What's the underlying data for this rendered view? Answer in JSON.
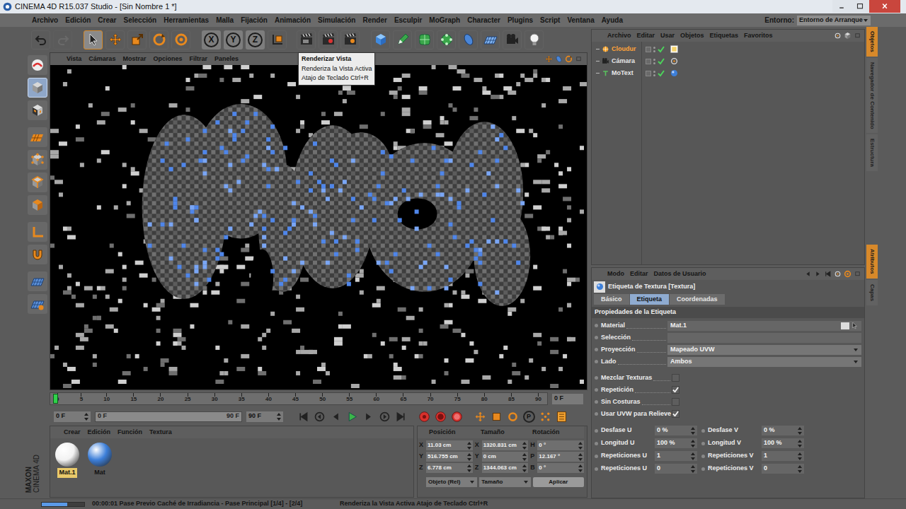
{
  "window": {
    "title": "CINEMA 4D R15.037 Studio - [Sin Nombre 1 *]",
    "controls": [
      {
        "kind": "minimize"
      },
      {
        "kind": "maximize"
      },
      {
        "kind": "close"
      }
    ]
  },
  "menu": [
    "Archivo",
    "Edición",
    "Crear",
    "Selección",
    "Herramientas",
    "Malla",
    "Fijación",
    "Animación",
    "Simulación",
    "Render",
    "Esculpir",
    "MoGraph",
    "Character",
    "Plugins",
    "Script",
    "Ventana",
    "Ayuda"
  ],
  "layout": {
    "label": "Entorno:",
    "value": "Entorno de Arranque"
  },
  "toolbar": [
    {
      "kind": "undo",
      "label": "",
      "selected": false,
      "disabled": false
    },
    {
      "kind": "redo",
      "label": "",
      "selected": false,
      "disabled": true
    },
    {
      "kind": "select",
      "label": "",
      "selected": true,
      "disabled": false
    },
    {
      "kind": "move",
      "label": "",
      "selected": false,
      "disabled": false
    },
    {
      "kind": "scale",
      "label": "",
      "selected": false,
      "disabled": false
    },
    {
      "kind": "rotate",
      "label": "",
      "selected": false,
      "disabled": false
    },
    {
      "kind": "recent",
      "label": "",
      "selected": false,
      "disabled": false
    },
    {
      "kind": "axis",
      "label": "X",
      "selected": true,
      "disabled": false
    },
    {
      "kind": "axis",
      "label": "Y",
      "selected": true,
      "disabled": false
    },
    {
      "kind": "axis",
      "label": "Z",
      "selected": true,
      "disabled": false
    },
    {
      "kind": "coords",
      "label": "",
      "selected": false,
      "disabled": false
    },
    {
      "kind": "render-view",
      "label": "",
      "selected": false,
      "disabled": false
    },
    {
      "kind": "render-picture",
      "label": "",
      "selected": false,
      "disabled": false
    },
    {
      "kind": "render-settings",
      "label": "",
      "selected": false,
      "disabled": false
    },
    {
      "kind": "cube",
      "label": "",
      "selected": false,
      "disabled": false
    },
    {
      "kind": "pen",
      "label": "",
      "selected": false,
      "disabled": false
    },
    {
      "kind": "subdivision",
      "label": "",
      "selected": false,
      "disabled": false
    },
    {
      "kind": "array",
      "label": "",
      "selected": false,
      "disabled": false
    },
    {
      "kind": "deformer",
      "label": "",
      "selected": false,
      "disabled": false
    },
    {
      "kind": "floor",
      "label": "",
      "selected": false,
      "disabled": false
    },
    {
      "kind": "camera",
      "label": "",
      "selected": false,
      "disabled": false
    },
    {
      "kind": "light",
      "label": "",
      "selected": false,
      "disabled": false
    }
  ],
  "left_toolbar": [
    {
      "kind": "make-editable",
      "selected": false
    },
    {
      "kind": "model",
      "selected": true
    },
    {
      "kind": "texture",
      "selected": false
    },
    {
      "kind": "workplane",
      "selected": false
    },
    {
      "kind": "points",
      "selected": false
    },
    {
      "kind": "edges",
      "selected": false
    },
    {
      "kind": "polygons",
      "selected": false
    },
    {
      "kind": "axis-mode",
      "selected": false
    },
    {
      "kind": "tweak",
      "selected": false
    },
    {
      "kind": "snap",
      "selected": false
    },
    {
      "kind": "snap-settings",
      "selected": false
    }
  ],
  "brand": {
    "top": "MAXON",
    "bottom": "CINEMA 4D"
  },
  "tooltip": {
    "title": "Renderizar Vista",
    "lines": [
      "Renderiza la Vista Activa",
      "Atajo de Teclado Ctrl+R"
    ]
  },
  "viewport": {
    "menu": [
      "Vista",
      "Cámaras",
      "Mostrar",
      "Opciones",
      "Filtrar",
      "Paneles"
    ]
  },
  "timeline": {
    "ticks": [
      "0",
      "5",
      "10",
      "15",
      "20",
      "25",
      "30",
      "35",
      "40",
      "45",
      "50",
      "55",
      "60",
      "65",
      "70",
      "75",
      "80",
      "85",
      "90"
    ],
    "level": 0,
    "current": "0 F"
  },
  "transport": {
    "start": "0 F",
    "range_start": "0 F",
    "range_end": "90 F",
    "end": "90 F",
    "buttons": [
      {
        "kind": "first",
        "label": ""
      },
      {
        "kind": "prev-key",
        "label": ""
      },
      {
        "kind": "prev-frame",
        "label": ""
      },
      {
        "kind": "play",
        "label": ""
      },
      {
        "kind": "next-frame",
        "label": ""
      },
      {
        "kind": "next-key",
        "label": ""
      },
      {
        "kind": "last",
        "label": ""
      },
      {
        "kind": "record",
        "label": ""
      },
      {
        "kind": "autokey",
        "label": ""
      },
      {
        "kind": "keysel",
        "label": ""
      },
      {
        "kind": "move-key",
        "label": ""
      },
      {
        "kind": "scale-key",
        "label": ""
      },
      {
        "kind": "rotate-key",
        "label": ""
      },
      {
        "kind": "param-key",
        "label": "P"
      },
      {
        "kind": "point-key",
        "label": ""
      },
      {
        "kind": "timeline",
        "label": ""
      }
    ]
  },
  "materials": {
    "menu": [
      "Crear",
      "Edición",
      "Función",
      "Textura"
    ],
    "items": [
      {
        "name": "Mat.1",
        "selected": true,
        "color": "#f2f2f2"
      },
      {
        "name": "Mat",
        "selected": false,
        "color": "#3d7fd9"
      }
    ]
  },
  "coordinates": {
    "headers": [
      "Posición",
      "Tamaño",
      "Rotación"
    ],
    "rows": [
      [
        {
          "axis": "X",
          "value": "11.03 cm"
        },
        {
          "axis": "X",
          "value": "1320.831 cm"
        },
        {
          "axis": "H",
          "value": "0 °"
        }
      ],
      [
        {
          "axis": "Y",
          "value": "516.755 cm"
        },
        {
          "axis": "Y",
          "value": "0 cm"
        },
        {
          "axis": "P",
          "value": "12.167 °"
        }
      ],
      [
        {
          "axis": "Z",
          "value": "6.778 cm"
        },
        {
          "axis": "Z",
          "value": "1344.063 cm"
        },
        {
          "axis": "B",
          "value": "0 °"
        }
      ]
    ],
    "mode": "Objeto (Rel)",
    "size_mode": "Tamaño",
    "apply": "Aplicar"
  },
  "objects": {
    "menu": [
      "Archivo",
      "Editar",
      "Usar",
      "Objetos",
      "Etiquetas",
      "Favoritos"
    ],
    "items": [
      {
        "name": "Cloudur",
        "selected": true,
        "enabled": true,
        "kind": "sky",
        "tag": "display"
      },
      {
        "name": "Cámara",
        "selected": false,
        "enabled": true,
        "kind": "camera",
        "tag": "target"
      },
      {
        "name": "MoText",
        "selected": false,
        "enabled": true,
        "kind": "text",
        "tag": "texture"
      }
    ]
  },
  "attributes": {
    "menu": [
      "Modo",
      "Editar",
      "Datos de Usuario"
    ],
    "title": "Etiqueta de Textura [Textura]",
    "tabs": [
      {
        "label": "Básico",
        "selected": false
      },
      {
        "label": "Etiqueta",
        "selected": true
      },
      {
        "label": "Coordenadas",
        "selected": false
      }
    ],
    "section": "Propiedades de la Etiqueta",
    "fields": [
      {
        "label": "Material",
        "kind": "link",
        "value": "Mat.1"
      },
      {
        "label": "Selección",
        "kind": "text",
        "value": ""
      },
      {
        "label": "Proyección",
        "kind": "dropdown",
        "value": "Mapeado UVW"
      },
      {
        "label": "Lado",
        "kind": "dropdown",
        "value": "Ambos"
      }
    ],
    "checks": [
      {
        "label": "Mezclar Texturas",
        "checked": false
      },
      {
        "label": "Repetición",
        "checked": true
      },
      {
        "label": "Sin Costuras",
        "checked": false
      },
      {
        "label": "Usar UVW para Relieve",
        "checked": true
      }
    ],
    "pairs": [
      [
        {
          "label": "Desfase U",
          "value": "0 %"
        },
        {
          "label": "Desfase V",
          "value": "0 %"
        }
      ],
      [
        {
          "label": "Longitud U",
          "value": "100 %"
        },
        {
          "label": "Longitud V",
          "value": "100 %"
        }
      ],
      [
        {
          "label": "Repeticiones U",
          "value": "1"
        },
        {
          "label": "Repeticiones V",
          "value": "1"
        }
      ],
      [
        {
          "label": "Repeticiones U",
          "value": "0"
        },
        {
          "label": "Repeticiones V",
          "value": "0"
        }
      ]
    ]
  },
  "side_tabs": {
    "top": [
      {
        "label": "Objetos",
        "selected": true
      },
      {
        "label": "Navegador de Contenido",
        "selected": false
      },
      {
        "label": "Estructura",
        "selected": false
      }
    ],
    "bottom": [
      {
        "label": "Atributos",
        "selected": true
      },
      {
        "label": "Capas",
        "selected": false
      }
    ]
  },
  "status": {
    "level": 0.6,
    "progress": "00:00:01 Pase Previo Caché de Irradiancia - Pase Principal [1/4] - [2/4]",
    "hint": "Renderiza la Vista Activa Atajo de Teclado Ctrl+R"
  }
}
